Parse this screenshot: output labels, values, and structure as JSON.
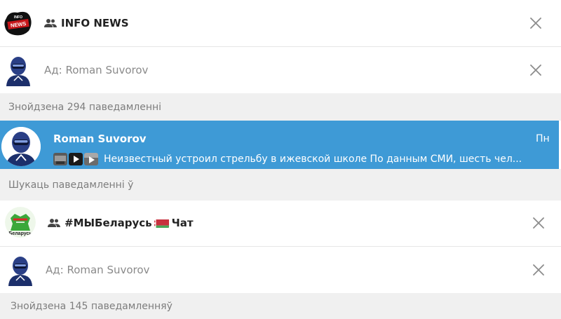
{
  "chats": [
    {
      "title": "INFO NEWS",
      "avatar_icon": "info-news-logo",
      "group_icon": "group-icon",
      "from_label": "Ад: Roman Suvorov",
      "found_label": "Знойдзена 294 паведамленні"
    },
    {
      "title": "#МЫБеларусь",
      "title_suffix": "Чат",
      "flag_icon": "belarus-flag-icon",
      "avatar_icon": "belarus-logo",
      "group_icon": "group-icon",
      "from_label": "Ад: Roman Suvorov",
      "found_label": "Знойдзена 145 паведамленняў"
    }
  ],
  "result": {
    "sender": "Roman Suvorov",
    "day": "Пн",
    "preview": "Неизвестный устроил стрельбу в ижевской школе  По данным СМИ, шесть чел..."
  },
  "search_messages_label": "Шукаць паведамленні ў",
  "colors": {
    "selected": "#3e9ad6",
    "section_bg": "#f0f0f0",
    "muted_text": "#8a8a8a"
  }
}
